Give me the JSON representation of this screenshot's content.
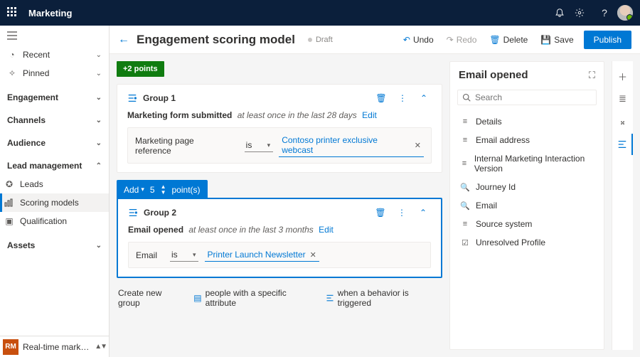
{
  "topbar": {
    "app": "Marketing"
  },
  "nav": {
    "recent": "Recent",
    "pinned": "Pinned",
    "sections": {
      "engagement": "Engagement",
      "channels": "Channels",
      "audience": "Audience",
      "lead_mgmt": "Lead management",
      "assets": "Assets"
    },
    "lead_items": {
      "leads": "Leads",
      "scoring": "Scoring models",
      "qualification": "Qualification"
    },
    "area": {
      "abbr": "RM",
      "label": "Real-time marketi..."
    }
  },
  "cmdbar": {
    "title": "Engagement scoring model",
    "state": "Draft",
    "undo": "Undo",
    "redo": "Redo",
    "delete": "Delete",
    "save": "Save",
    "publish": "Publish"
  },
  "canvas": {
    "points_tag": "+2 points",
    "group1": {
      "name": "Group 1",
      "cond_name": "Marketing form submitted",
      "cond_window": "at least once in the last 28 days",
      "edit": "Edit",
      "attr_label": "Marketing page reference",
      "operator": "is",
      "value": "Contoso printer exclusive webcast"
    },
    "addbar": {
      "add": "Add",
      "count": "5",
      "unit": "point(s)"
    },
    "group2": {
      "name": "Group 2",
      "cond_name": "Email opened",
      "cond_window": "at least once in the last 3 months",
      "edit": "Edit",
      "attr_label": "Email",
      "operator": "is",
      "value": "Printer Launch Newsletter"
    },
    "create": {
      "label": "Create new group",
      "attribute": "people with a specific attribute",
      "behavior": "when a behavior is triggered"
    }
  },
  "side": {
    "title": "Email opened",
    "search_ph": "Search",
    "items": [
      "Details",
      "Email address",
      "Internal Marketing Interaction Version",
      "Journey Id",
      "Email",
      "Source system",
      "Unresolved Profile"
    ]
  }
}
